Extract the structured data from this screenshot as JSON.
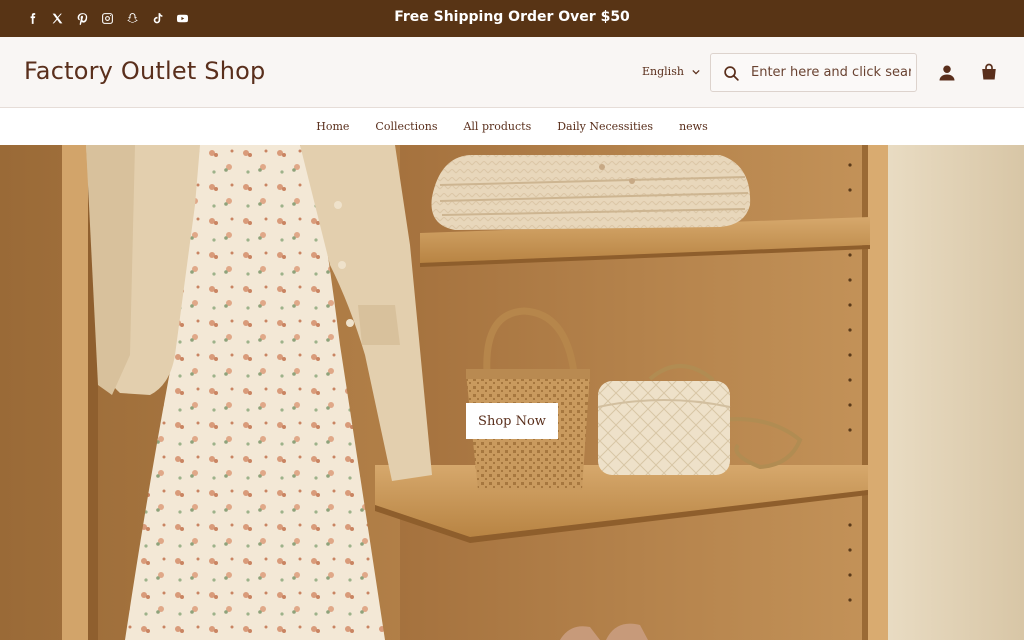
{
  "announcement": {
    "text": "Free Shipping Order Over $50"
  },
  "socials": [
    {
      "icon": "facebook-icon"
    },
    {
      "icon": "x-icon"
    },
    {
      "icon": "pinterest-icon"
    },
    {
      "icon": "instagram-icon"
    },
    {
      "icon": "snapchat-icon"
    },
    {
      "icon": "tiktok-icon"
    },
    {
      "icon": "youtube-icon"
    }
  ],
  "header": {
    "logo": "Factory Outlet Shop",
    "language": "English",
    "search_placeholder": "Enter here and click search",
    "account_icon": "account-icon",
    "cart_icon": "cart-icon"
  },
  "nav": {
    "items": [
      {
        "label": "Home"
      },
      {
        "label": "Collections"
      },
      {
        "label": "All products"
      },
      {
        "label": "Daily Necessities"
      },
      {
        "label": "news"
      }
    ]
  },
  "hero": {
    "button_label": "Shop Now"
  },
  "colors": {
    "brand_dark": "#583415",
    "text": "#5a2f1c",
    "header_bg": "#f9f6f4"
  }
}
